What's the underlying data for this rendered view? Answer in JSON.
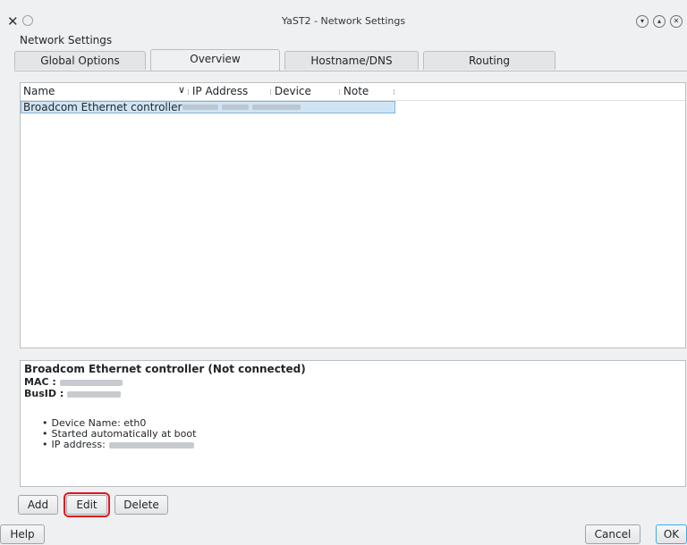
{
  "window": {
    "title": "YaST2 - Network Settings",
    "heading": "Network Settings"
  },
  "tabs": [
    {
      "label": "Global Options",
      "active": false
    },
    {
      "label": "Overview",
      "active": true
    },
    {
      "label": "Hostname/DNS",
      "active": false
    },
    {
      "label": "Routing",
      "active": false
    }
  ],
  "table": {
    "columns": [
      "Name",
      "IP Address",
      "Device",
      "Note"
    ],
    "rows": [
      {
        "name": "Broadcom Ethernet controller",
        "ip_address_redacted": true,
        "selected": true
      }
    ]
  },
  "details": {
    "title": "Broadcom Ethernet controller (Not connected)",
    "mac_label": "MAC :",
    "busid_label": "BusID :",
    "items": [
      "Device Name: eth0",
      "Started automatically at boot",
      "IP address:"
    ],
    "bullet": "•"
  },
  "buttons": {
    "add": "Add",
    "edit": "Edit",
    "delete": "Delete",
    "help": "Help",
    "cancel": "Cancel",
    "ok": "OK"
  },
  "icons": {
    "sort": "chevron-down-icon"
  },
  "colors": {
    "selection": "#cfe5f6",
    "highlight_box": "#e0181d"
  }
}
